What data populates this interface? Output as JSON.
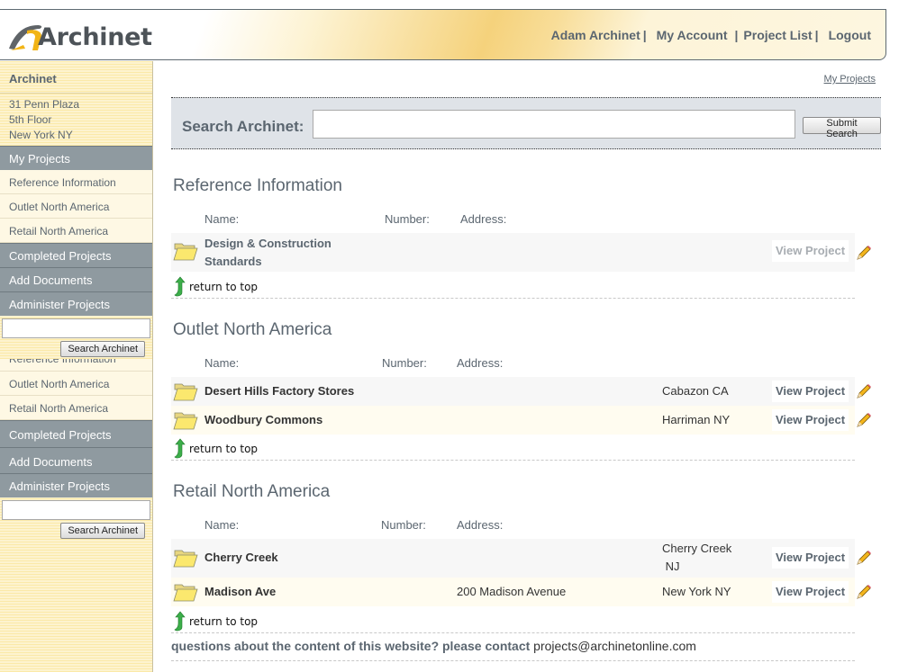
{
  "header": {
    "logo_text": "Archinet",
    "nav": [
      {
        "label": "Adam Archinet",
        "sep": "|"
      },
      {
        "label": "My Account",
        "sep": "|"
      },
      {
        "label": "Project List",
        "sep": "|"
      },
      {
        "label": "Logout",
        "sep": ""
      }
    ]
  },
  "sidebar": {
    "title": "Archinet",
    "address": [
      "31 Penn Plaza",
      "5th Floor",
      "New York  NY"
    ],
    "my_projects": "My Projects",
    "project_links": [
      "Reference Information",
      "Outlet North America",
      "Retail North America"
    ],
    "completed": "Completed Projects",
    "add_documents": "Add Documents",
    "administer": "Administer Projects",
    "search_button": "Search Archinet",
    "search_value": ""
  },
  "main": {
    "my_projects_link": "My Projects",
    "search": {
      "label": "Search Archinet:",
      "value": "",
      "button": "Submit Search"
    },
    "columns": {
      "name": "Name:",
      "number": "Number:",
      "address": "Address:"
    },
    "return_to_top": "return to top",
    "view_project": "View Project",
    "sections": [
      {
        "title": "Reference Information",
        "projects": [
          {
            "name_line1": "Design & Construction",
            "name_line2": "Standards",
            "number": "",
            "address": "",
            "city": "",
            "state": ""
          }
        ]
      },
      {
        "title": "Outlet North America",
        "projects": [
          {
            "name": "Desert Hills Factory Stores",
            "number": "",
            "address": "",
            "city_state": "Cabazon  CA"
          },
          {
            "name": "Woodbury Commons",
            "number": "",
            "address": "",
            "city_state": "Harriman  NY"
          }
        ]
      },
      {
        "title": "Retail North America",
        "projects": [
          {
            "name": "Cherry Creek",
            "number": "",
            "address": "",
            "city_line1": "Cherry Creek",
            "city_line2": " NJ"
          },
          {
            "name": "Madison Ave",
            "number": "",
            "address": "200 Madison Avenue",
            "city_state": "New York  NY"
          }
        ]
      }
    ],
    "footer": {
      "question": "questions about the content of this website? please contact",
      "email": "projects@archinetonline.com"
    }
  },
  "colors": {
    "accent_gold": "#f5d27c",
    "nav_dark": "#8f9aa0",
    "text_slate": "#5b6670",
    "search_bg": "#dfe3e8"
  }
}
